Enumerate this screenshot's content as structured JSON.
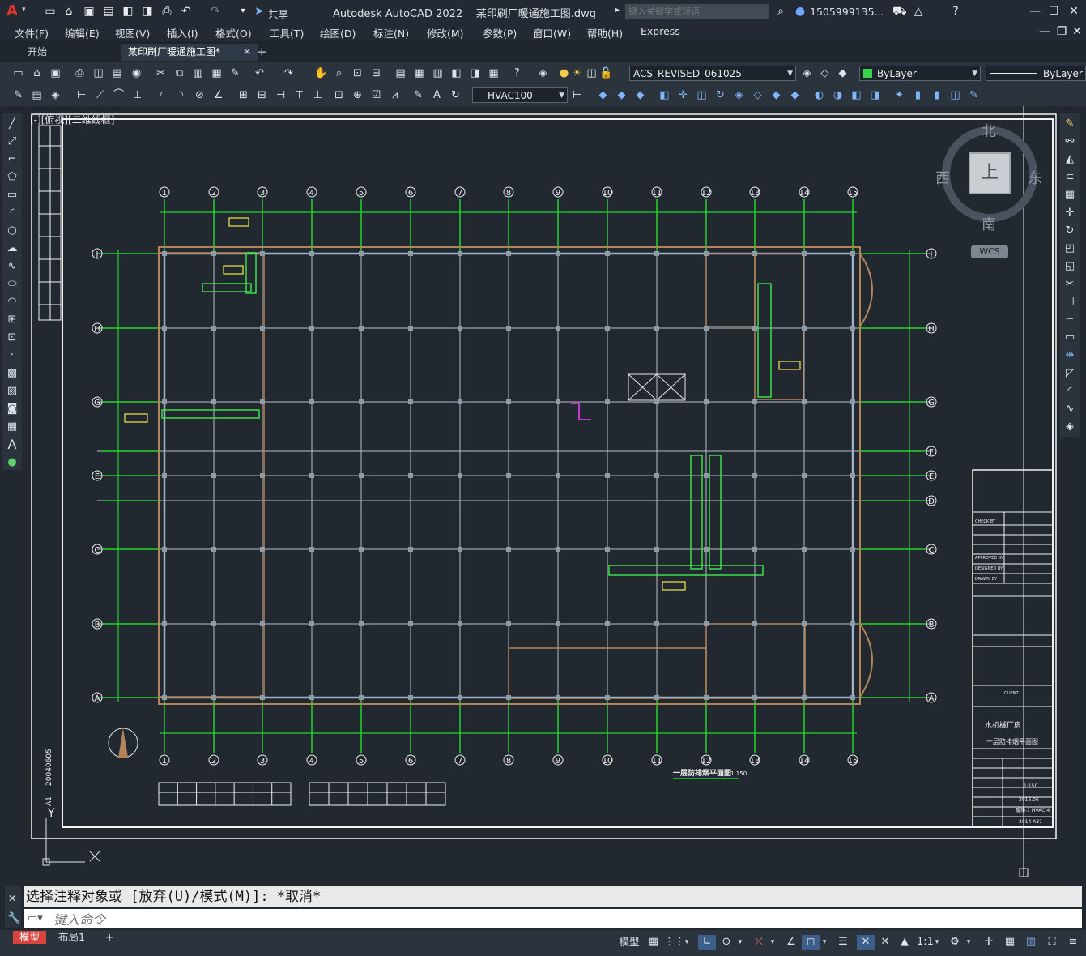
{
  "app": {
    "title": "Autodesk AutoCAD 2022    某印刷厂暖通施工图.dwg",
    "share_label": "共享",
    "search_placeholder": "键入关键字或短语",
    "user": "1505999135...",
    "logo": "A"
  },
  "menu": [
    "文件(F)",
    "编辑(E)",
    "视图(V)",
    "插入(I)",
    "格式(O)",
    "工具(T)",
    "绘图(D)",
    "标注(N)",
    "修改(M)",
    "参数(P)",
    "窗口(W)",
    "帮助(H)",
    "Express"
  ],
  "tabs": {
    "start": "开始",
    "active": "某印刷厂暖通施工图*",
    "close": "✕",
    "add": "+"
  },
  "toolbar": {
    "layer": "ACS_REVISED_061025",
    "color": "ByLayer",
    "linetype": "ByLayer",
    "dimstyle": "HVAC100"
  },
  "viewport": {
    "label": "[-][俯视][二维线框]"
  },
  "viewcube": {
    "north": "北",
    "south": "南",
    "east": "东",
    "west": "西",
    "top": "上",
    "wcs": "WCS"
  },
  "drawing": {
    "columns": [
      "1",
      "2",
      "3",
      "4",
      "5",
      "6",
      "7",
      "8",
      "9",
      "10",
      "11",
      "12",
      "13",
      "14",
      "15"
    ],
    "rows": [
      "J",
      "H",
      "G",
      "F",
      "E",
      "D",
      "C",
      "B",
      "A"
    ],
    "plan_title": "一层防排烟平面图",
    "plan_scale": "1:150",
    "titleblock": {
      "check": "CHECK BY",
      "approved": "APPROVED BY",
      "designed": "DESIGNED BY",
      "drawn": "DRAWN BY",
      "client": "CLIENT",
      "project": "水机械厂房",
      "sheet": "一层防排烟平面图",
      "scale": "1:150",
      "date": "2016.06",
      "drawing_no": "暖施-1 HVAC-4",
      "project_no": "2014-A31"
    },
    "sheet_code": "20040605",
    "paper": "A1",
    "ucs_y": "Y"
  },
  "command": {
    "history": "选择注释对象或 [放弃(U)/模式(M)]: *取消*",
    "placeholder": "键入命令"
  },
  "status": {
    "model_tab": "模型",
    "layout_tab": "布局1",
    "model_btn": "模型",
    "scale": "1:1"
  }
}
